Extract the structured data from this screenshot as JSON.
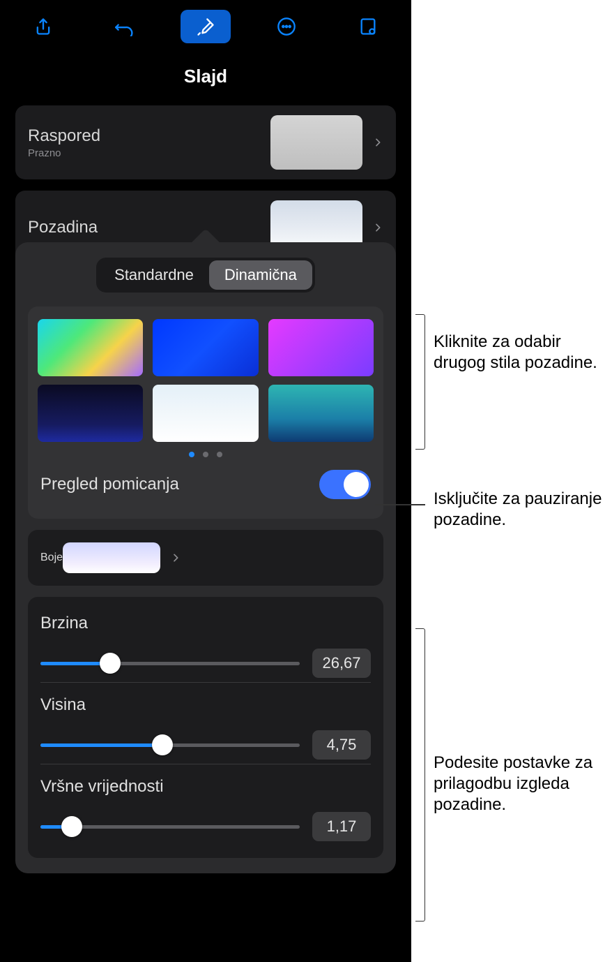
{
  "title": "Slajd",
  "layout_row": {
    "label": "Raspored",
    "sub": "Prazno"
  },
  "background_row": {
    "label": "Pozadina"
  },
  "segment": {
    "standard": "Standardne",
    "dynamic": "Dinamična"
  },
  "preview_toggle": {
    "label": "Pregled pomicanja",
    "on": true
  },
  "colors_row": {
    "label": "Boje"
  },
  "sliders": {
    "speed": {
      "label": "Brzina",
      "value": "26,67",
      "pct": 27
    },
    "height": {
      "label": "Visina",
      "value": "4,75",
      "pct": 47
    },
    "peaks": {
      "label": "Vršne vrijednosti",
      "value": "1,17",
      "pct": 12
    }
  },
  "callouts": {
    "c1": "Kliknite za odabir drugog stila pozadine.",
    "c2": "Isključite za pauziranje pozadine.",
    "c3": "Podesite postavke za prilagodbu izgleda pozadine."
  }
}
